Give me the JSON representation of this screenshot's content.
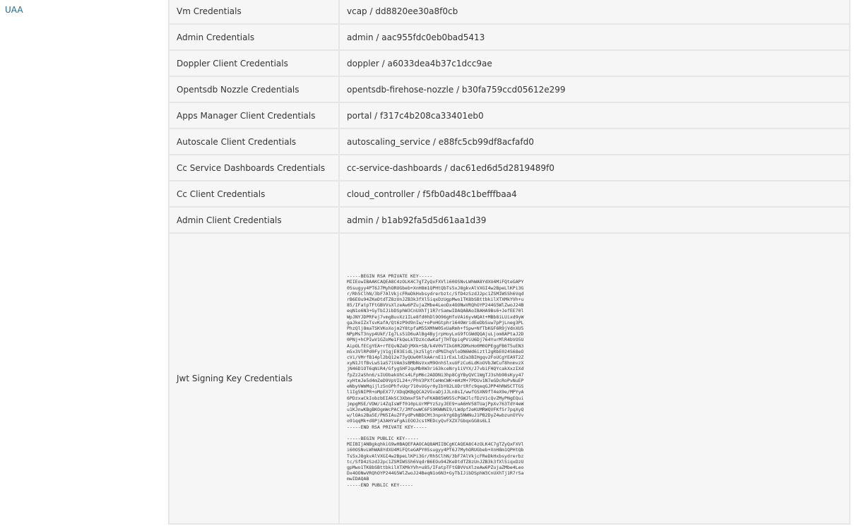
{
  "sidebar": {
    "link_label": "UAA"
  },
  "credentials": [
    {
      "label": "Vm Credentials",
      "value": "vcap / dd8820ee30a8f0cb"
    },
    {
      "label": "Admin Credentials",
      "value": "admin / aac955fdc0eb0bad5413"
    },
    {
      "label": "Doppler Client Credentials",
      "value": "doppler / a6033dea4b37c1dcc9ae"
    },
    {
      "label": "Opentsdb Nozzle Credentials",
      "value": "opentsdb-firehose-nozzle / b30fa759ccd05612e299"
    },
    {
      "label": "Apps Manager Client Credentials",
      "value": "portal / f317c4b208ca33401eb0"
    },
    {
      "label": "Autoscale Client Credentials",
      "value": "autoscaling_service / e88fc5cb99df8acfafd0"
    },
    {
      "label": "Cc Service Dashboards Credentials",
      "value": "cc-service-dashboards / dac61ed6d5d2819489f0"
    },
    {
      "label": "Cc Client Credentials",
      "value": "cloud_controller / f5fb0ad48c1befffbaa4"
    },
    {
      "label": "Admin Client Credentials",
      "value": "admin / b1ab92fa5d5d61aa1d39"
    }
  ],
  "jwt": {
    "label": "Jwt Signing Key Credentials",
    "value": "-----BEGIN RSA PRIVATE KEY-----\nMIIEowIBAAKCAQEA8C4zOLK4C7gTZyQxFXVli60OSNvLWhWA8YdXU4MiFQteGAPY\n0Ssugyy4PT6J7MyhORUGbeb+XnH8m1QPHtQbTs5xJ8gkvAlVXGI4w2BpeLlKPi3G\nr/Rh5ClhN/3bF7AlVkjcFReDkHxbsydrerbztc/SfD4zSzdJ2pc1ZSMIWSSh6Vqd\nrB6EOu94ZKeDtdTZ8zUnJZB3k3fXl5iqxDzUgpMwo1TK8bSBttbkilXTXMkYVh+u\n85/IFatpTFtGBVVsXlzeAw6PZujaZMbe4LeoDx4OONwVRQhOYP244G5WlZwoJ24B\neqN1o6N3+GyTbIJibDSphW3CnUXhTj1R7rSamwIDAQABAoIBAHA9Bs6+JefEE70l\nWpJNYJDPRFej7vmgBuvXz1ILe8fd0hDl9O96gHfoVAi6yvWQAt+MBb8iLUixd9yW\ngaJkeIZxTsvKafA/Qt6zP9d9nIw/+oPoHGtphr164OWridEeDbSuw7pPjLneg3PL\nPhzQlj8maTSKVKoXojm2Y8tpfaM55XMhW05xUaRmh+fSpw+NfTbKGF6R9jVdnXU5\nNPpMsT3nyp4UkF/Ig7Ls5iD6uAlBg4ByjrpHoyLxG9fCGWdQQAjuLjom8APtaJ2D\n0PNj+hCPIwV1GZoMe1FkQeLkTDzXcdwKafjTHTQpiqPViU6Dj764YurMlR4bVO5U\nAipOLfECgYEA+rfEQvNZeDjMXk+SB/k4V0VTIkG0R2DMxHo0M0OPEggFB6T5uEN3\nm5x3VlRPd0FyjV1gjE03EidLjkz5lgtrdPNIhqVloDN6Wd6iztl2gRbE024S68eO\ncVi/VMrfB14pl2bQ12e73yQUw0HlkAArnE11rExLld2a3BIHgqv2FoUCgYEA9T2Z\nxyN1JtfBvLwS1aS71VAm3sBMbNsVxxM9OnhSlxuUFzCu6LdKoOVbJWCuf8hnmvzX\njN46D1OT6qNiR4/GfygSHF2quMb0W3ri63kceNry1iVYX/J7vbiFHQYcakXxzIXd\nfpZz2aShn6/sIUObakUhCs4LFpM6c2ADDNi3hp8CgYByQVC1WgTJ3shb98sKyy47\nxyHtmJe5d4mZeD9VpVIL24+/PhV3PXfCeHmCWK+mHzM+7PDUv1N7eGDcRoPvNuEP\neNbyVWmMqijlz5nOPhfvUqr710vUGyr0yIbY82LUDrtRfc9qeqGJPP4hRWSCTTGS\nl1Ig5NIPR+oMpEX77/XDqQKBgQCA2VGvaDjJJLn8sI/wwfGSXN9fT4eX9e/MPYyA\n6PDzxaCkIobzbEIAkSC3XbmxF5kfvFKAB85W955cPGWJlcfDzV1cQvZMyPNgEQui\njmpgMSE/VDW/i4ZqIsWFf010pLUrMPYz5zyJEE9+uA6HV58TUajPpXv763TdY4eW\nu1KJnwKBgBKOgmWcPAC7/JMfowWC6FS9KWWNI9/LWdpf2eKUMRWQVFKfSr7pqXyQ\nw/lOAs2Ba5E/PN5IAuZFFydPvNBDCMt3npnkYg6Dg5NWNuJ1PB2DyZ4wbzunOYVv\no91qqMk+d8PjA3AHYaFgAiEOOJcstMEDcyQvFXZX7GbqxGG8s6LI\n-----END RSA PRIVATE KEY-----\n\n-----BEGIN PUBLIC KEY-----\nMIIBIjANBgkqhkiG9w0BAQEFAAOCAQ8AMIIBCgKCAQEA8C4zOLK4C7gTZyQxFXVl\ni60OSNvLWhWA8YdXU4MiFQteGAPY0Ssugyy4PT6J7MyhORUGbeb+XnH8m1QPHtQb\nTs5xJ8gkvAlVXGI4w2BpeLlKPi3Gr/Rh5ClhN/3bF7AlVkjcFReDkHxbsydrerbz\ntc/SfD4zSzdJ2pc1ZSMIWSSh6VqdrB6EOu94ZKeDtdTZ8zUnJZB3k3fXl5iqxDzU\ngpMwo1TK8bSBttbkilXTXMkYVh+u85/IFatpTFtGBVVsXlzeAw6PZujaZMbe4Leo\nDx4OONwVRQhOYP244G5WlZwoJ24BeqN1o6N3+GyTbIJibDSphW3CnUXhTj1R7rSa\nmwIDAQAB\n-----END PUBLIC KEY-----"
  }
}
